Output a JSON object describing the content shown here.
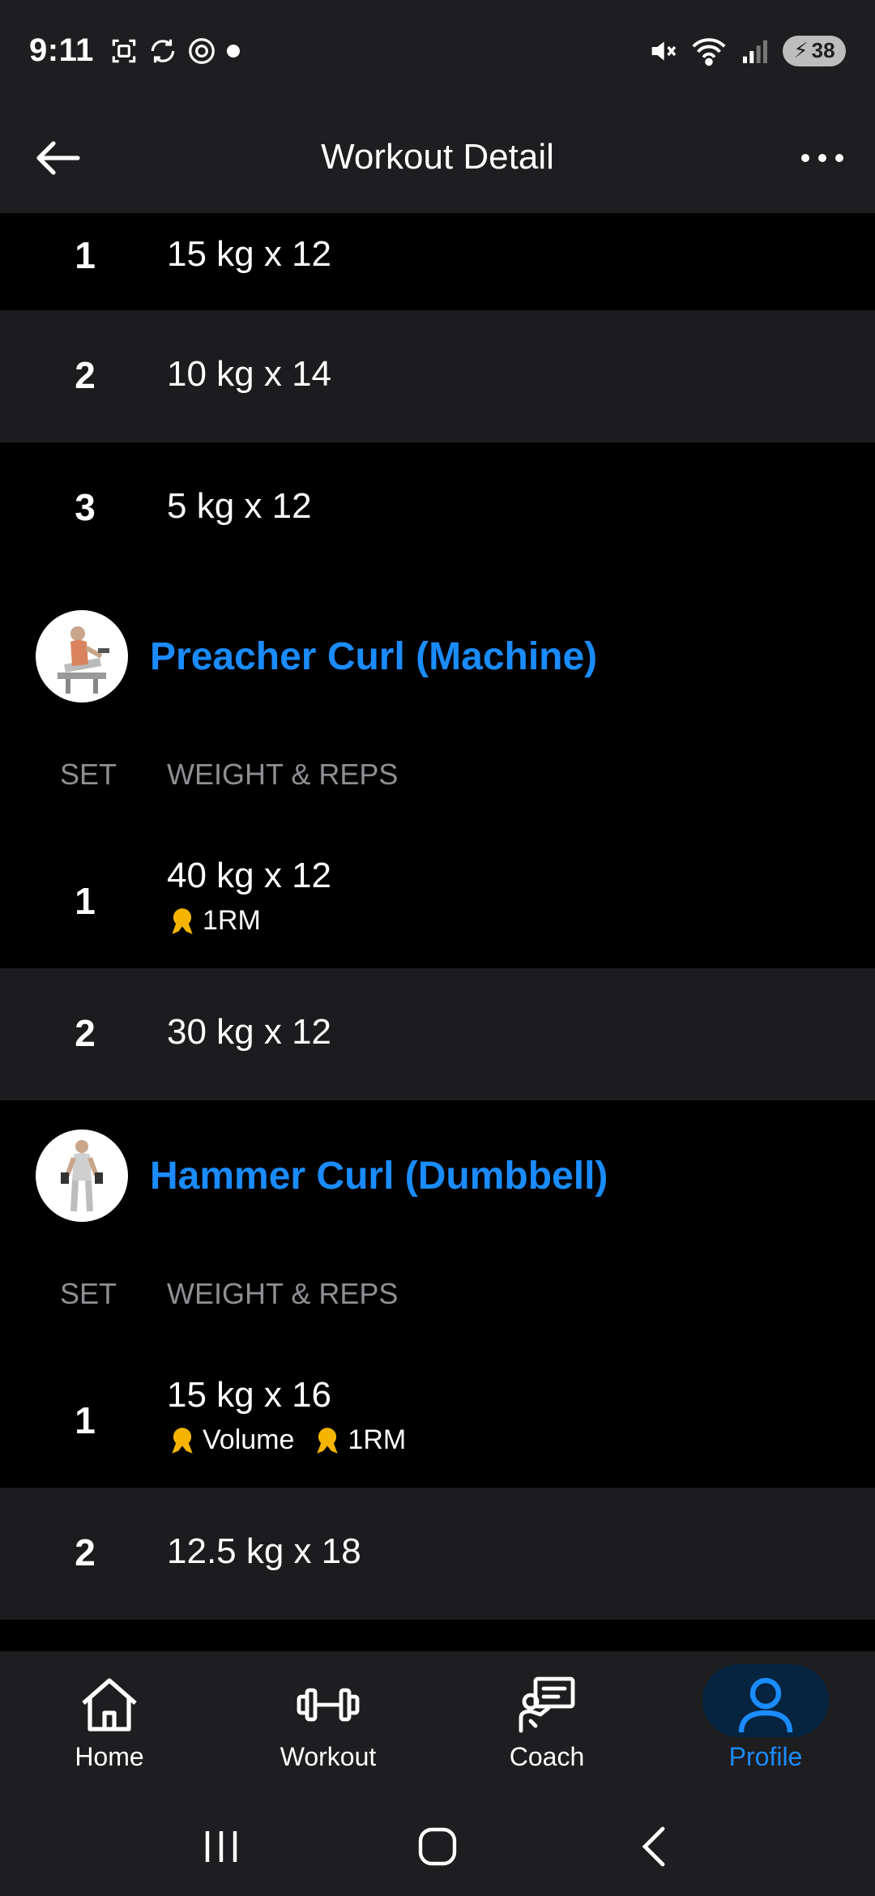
{
  "status_bar": {
    "time": "9:11",
    "battery": "38",
    "icons_left": [
      "screenshot-icon",
      "sync-icon",
      "at-sign-icon",
      "dot-icon"
    ],
    "icons_right": [
      "mute-icon",
      "wifi-icon",
      "signal-icon",
      "battery-icon"
    ]
  },
  "header": {
    "title": "Workout Detail",
    "back_icon": "arrow-left-icon",
    "more_icon": "more-horizontal-icon"
  },
  "top_sets": [
    {
      "set": "1",
      "value": "15 kg x 12"
    },
    {
      "set": "2",
      "value": "10 kg x 14"
    },
    {
      "set": "3",
      "value": "5 kg x 12"
    }
  ],
  "exercises": [
    {
      "title": "Preacher Curl (Machine)",
      "col_set": "SET",
      "col_weight_reps": "WEIGHT & REPS",
      "sets": [
        {
          "set": "1",
          "value": "40 kg x 12",
          "badges": [
            "1RM"
          ]
        },
        {
          "set": "2",
          "value": "30 kg x 12",
          "badges": []
        }
      ]
    },
    {
      "title": "Hammer Curl (Dumbbell)",
      "col_set": "SET",
      "col_weight_reps": "WEIGHT & REPS",
      "sets": [
        {
          "set": "1",
          "value": "15 kg x 16",
          "badges": [
            "Volume",
            "1RM"
          ]
        },
        {
          "set": "2",
          "value": "12.5 kg x 18",
          "badges": []
        }
      ]
    }
  ],
  "bottom_nav": [
    {
      "label": "Home",
      "icon": "home-icon",
      "active": false
    },
    {
      "label": "Workout",
      "icon": "dumbbell-icon",
      "active": false
    },
    {
      "label": "Coach",
      "icon": "coach-icon",
      "active": false
    },
    {
      "label": "Profile",
      "icon": "profile-icon",
      "active": true
    }
  ],
  "colors": {
    "accent": "#1a8cff",
    "background": "#000000",
    "surface": "#1e1e20",
    "alt_row": "#1c1c1e",
    "muted_text": "#8e8e93",
    "medal": "#f5b400"
  }
}
